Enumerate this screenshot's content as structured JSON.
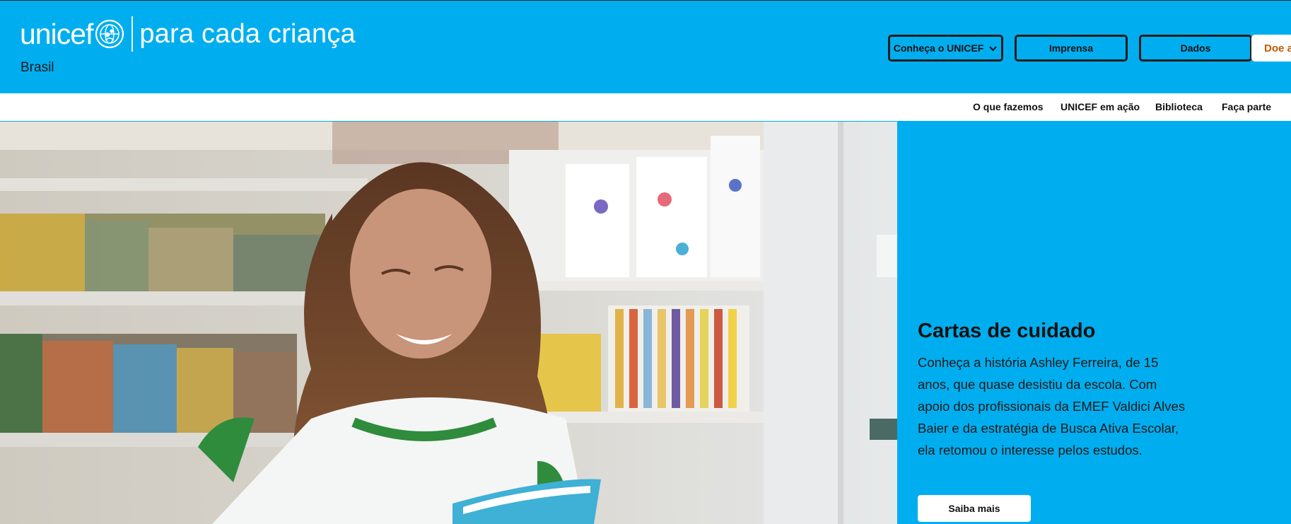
{
  "header": {
    "logo": {
      "wordmark": "unicef",
      "tagline": "para cada criança",
      "icon": "unicef-globe-icon"
    },
    "country": "Brasil",
    "nav": [
      {
        "label": "Conheça o UNICEF",
        "icon": "chevron-down-icon"
      },
      {
        "label": "Imprensa"
      },
      {
        "label": "Dados"
      }
    ],
    "donate_label": "Doe a"
  },
  "subnav": {
    "items": [
      "O que fazemos",
      "UNICEF em ação",
      "Biblioteca",
      "Faça parte"
    ]
  },
  "hero": {
    "title": "Cartas de cuidado",
    "text": "Conheça a história Ashley Ferreira, de 15 anos, que quase desistiu da escola. Com apoio dos profissionais da EMEF Valdici Alves Baier e da estratégia de Busca Ativa Escolar, ela retomou o interesse pelos estudos.",
    "cta_label": "Saiba mais"
  },
  "colors": {
    "brand_cyan": "#00aeef",
    "donate_text": "#c35a00",
    "text_dark": "#111111"
  }
}
